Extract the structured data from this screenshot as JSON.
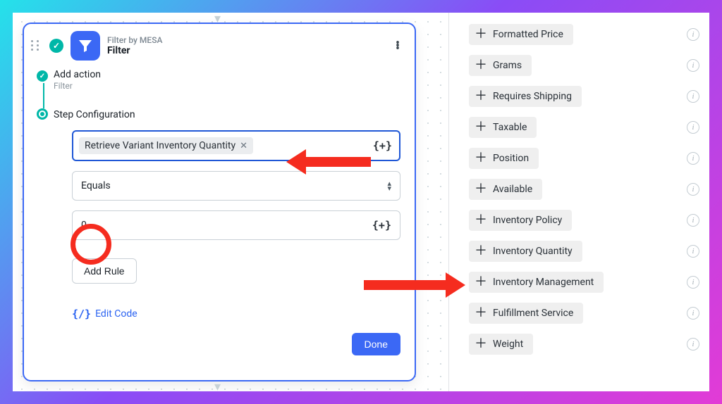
{
  "card": {
    "provider": "Filter by MESA",
    "title": "Filter",
    "addAction": {
      "label": "Add action",
      "sub": "Filter"
    },
    "stepConfig": "Step Configuration",
    "tokenChip": "Retrieve Variant Inventory Quantity",
    "operator": "Equals",
    "value": "0",
    "addRule": "Add Rule",
    "editCode": "Edit Code",
    "done": "Done"
  },
  "variables": [
    "Formatted Price",
    "Grams",
    "Requires Shipping",
    "Taxable",
    "Position",
    "Available",
    "Inventory Policy",
    "Inventory Quantity",
    "Inventory Management",
    "Fulfillment Service",
    "Weight"
  ]
}
